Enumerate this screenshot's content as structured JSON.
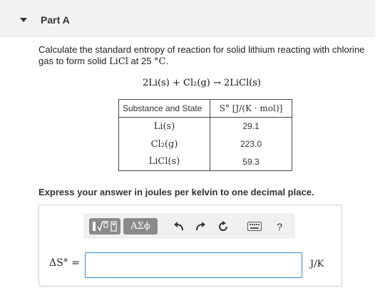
{
  "part": {
    "title": "Part A"
  },
  "question": {
    "text_before": "Calculate the standard entropy of reaction for solid lithium reacting with chlorine gas to form solid ",
    "formula": "LiCl",
    "text_middle": " at 25 ",
    "temperature_unit": "°C",
    "text_end": "."
  },
  "equation": "2Li(s) + Cl₂(g) → 2LiCl(s)",
  "table": {
    "headers": [
      "Substance and State",
      "S° [J/(K · mol)]"
    ],
    "rows": [
      {
        "substance": "Li(s)",
        "value": "29.1"
      },
      {
        "substance": "Cl₂(g)",
        "value": "223.0"
      },
      {
        "substance": "LiCl(s)",
        "value": "59.3"
      }
    ]
  },
  "instruction": "Express your answer in joules per kelvin to one decimal place.",
  "toolbar": {
    "templates_icon": "templates-icon",
    "greek_label": "ΑΣϕ",
    "undo_icon": "undo-icon",
    "redo_icon": "redo-icon",
    "reset_icon": "reset-icon",
    "keyboard_icon": "keyboard-icon",
    "help_label": "?"
  },
  "answer": {
    "label": "ΔS° =",
    "value": "",
    "unit": "J/K"
  },
  "colors": {
    "input_border": "#2a8fc7",
    "toolbar_button": "#8a8a8a",
    "header_bg": "#f2f2f2"
  }
}
